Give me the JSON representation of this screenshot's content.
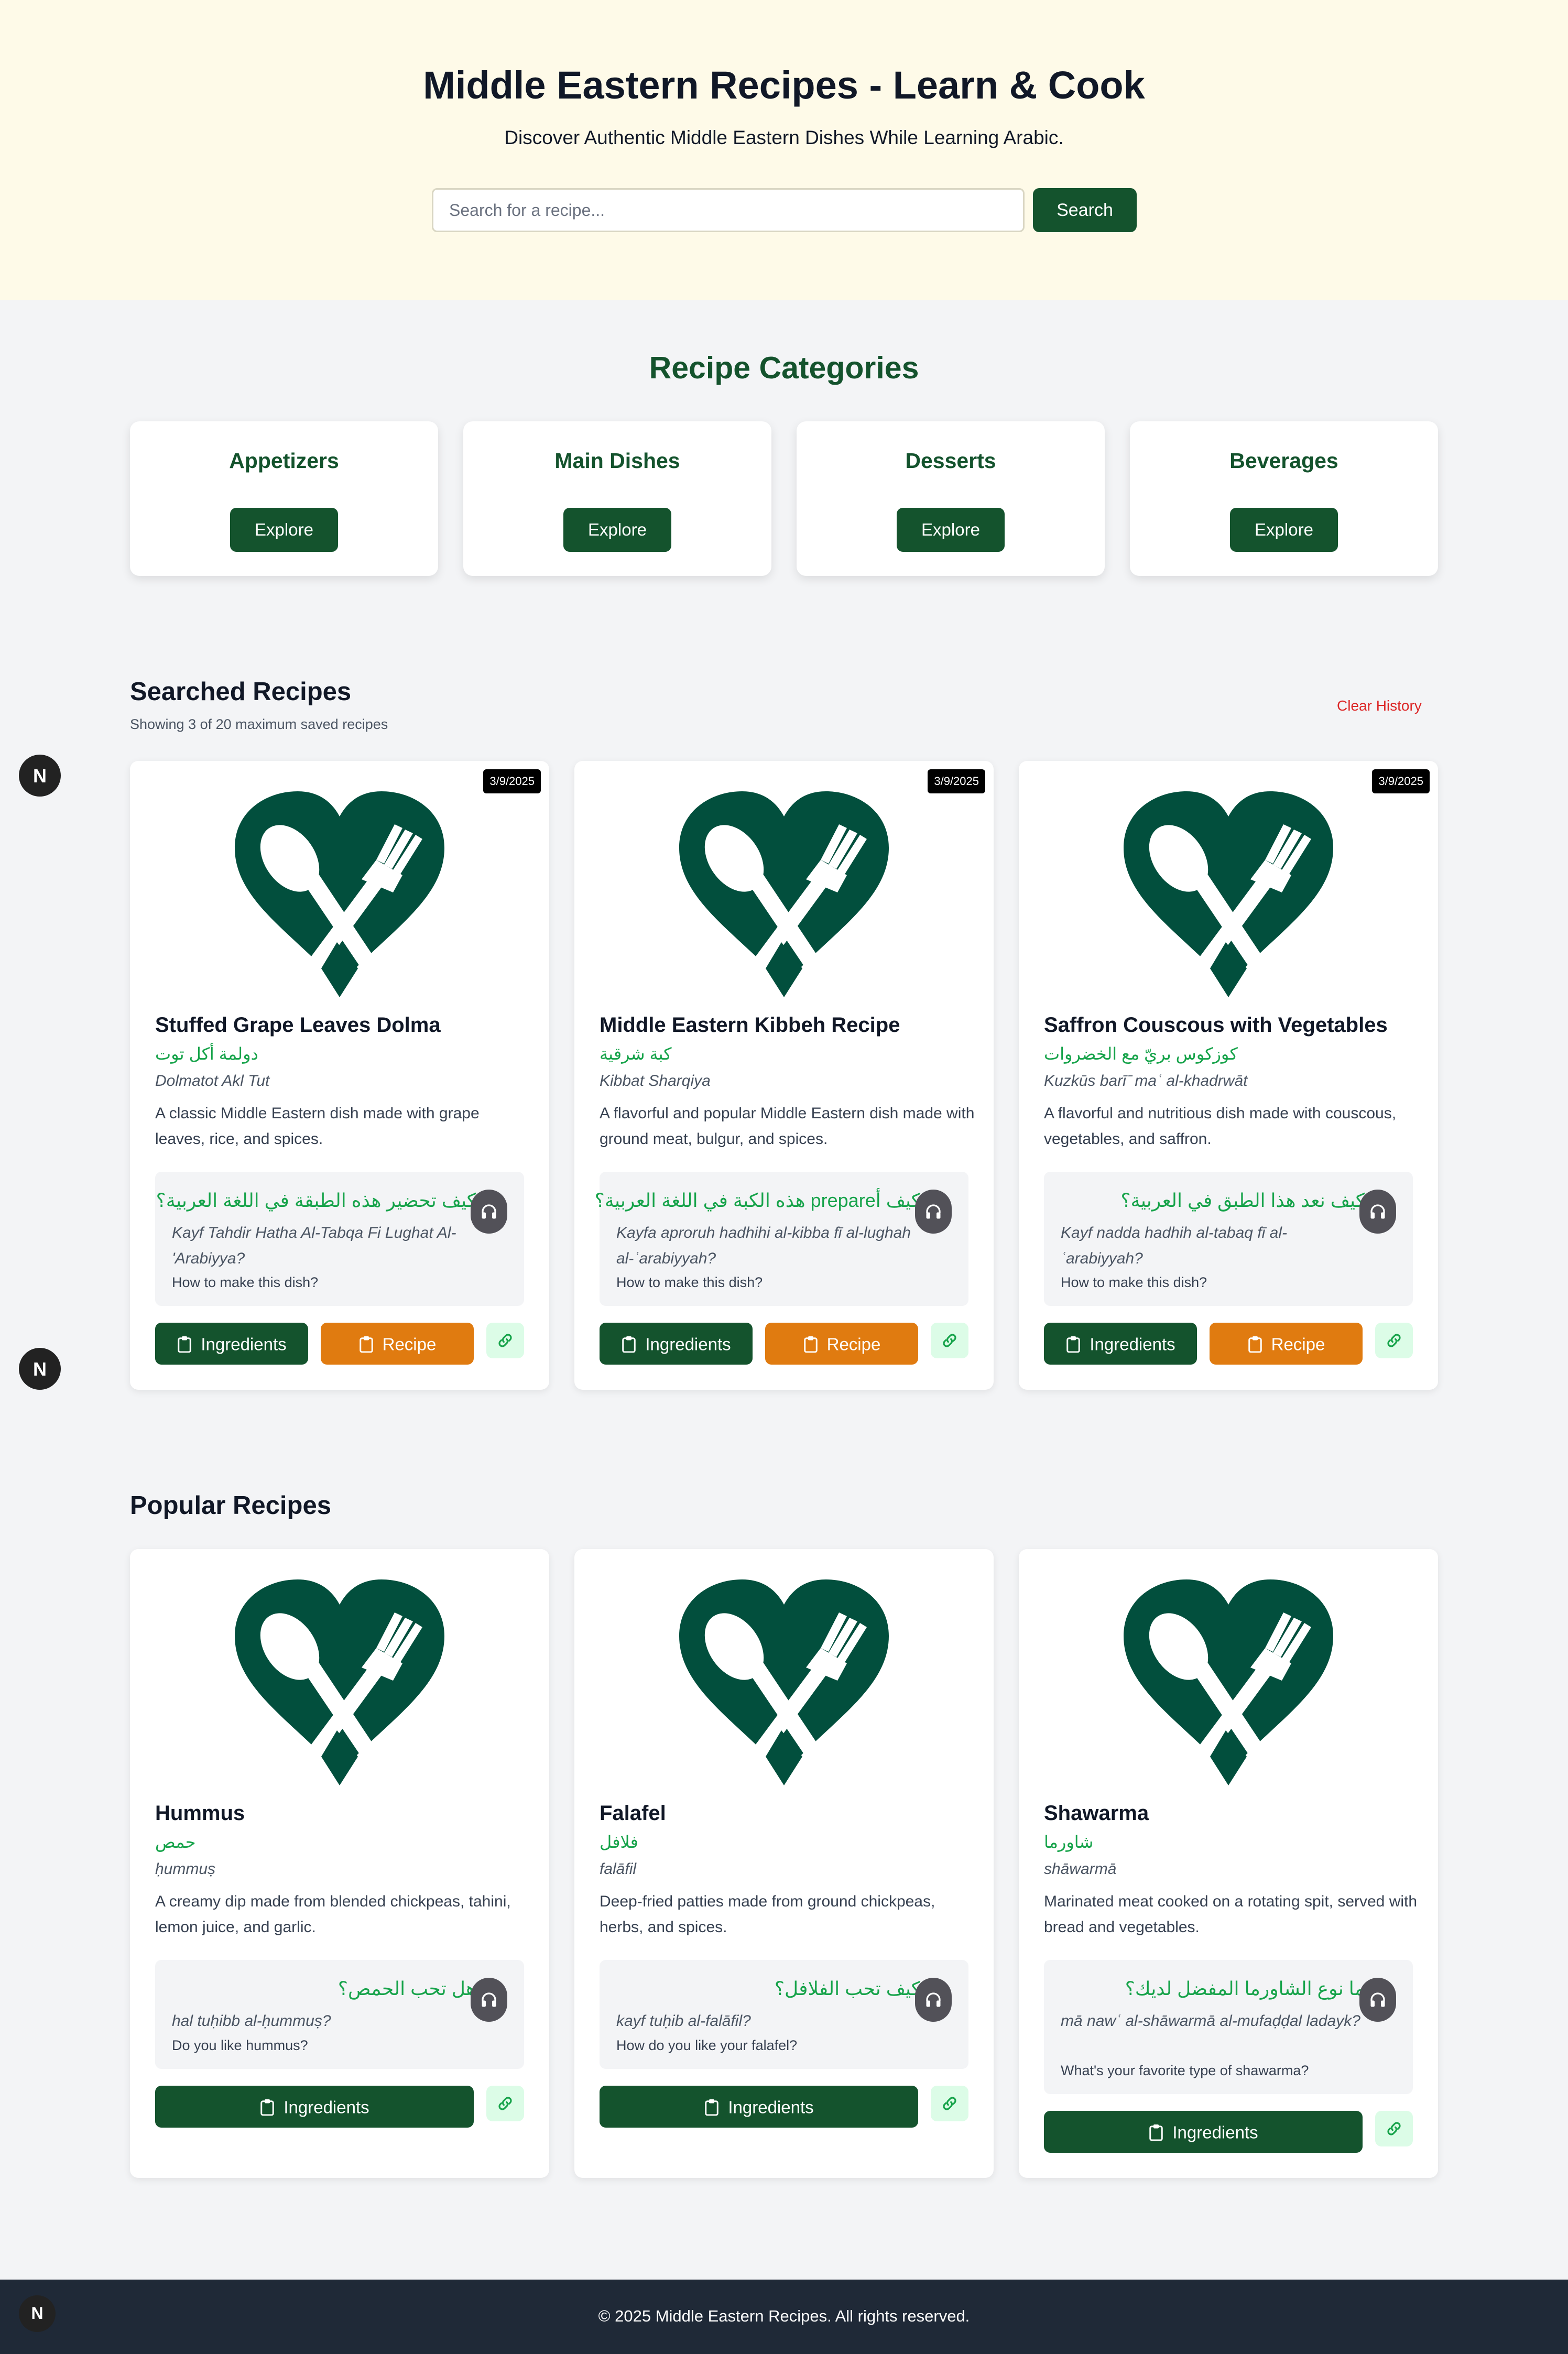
{
  "hero": {
    "title": "Middle Eastern Recipes - Learn & Cook",
    "subtitle": "Discover Authentic Middle Eastern Dishes While Learning Arabic.",
    "search_placeholder": "Search for a recipe...",
    "search_button": "Search"
  },
  "categories": {
    "title": "Recipe Categories",
    "items": [
      {
        "name": "Appetizers",
        "button": "Explore"
      },
      {
        "name": "Main Dishes",
        "button": "Explore"
      },
      {
        "name": "Desserts",
        "button": "Explore"
      },
      {
        "name": "Beverages",
        "button": "Explore"
      }
    ]
  },
  "searched": {
    "title": "Searched Recipes",
    "subtitle": "Showing 3 of 20 maximum saved recipes",
    "clear_label": "Clear History",
    "items": [
      {
        "date": "3/9/2025",
        "title": "Stuffed Grape Leaves Dolma",
        "arabic": "دولمة أكل توت",
        "translit": "Dolmatot Akl Tut",
        "desc": "A classic Middle Eastern dish made with grape leaves, rice, and spices.",
        "phrase_ar": "كيف تحضير هذه الطبقة في اللغة العربية؟",
        "phrase_tr": "Kayf Tahdir Hatha Al-Tabqa Fi Lughat Al-'Arabiyya?",
        "phrase_en": "How to make this dish?",
        "ing_label": "Ingredients",
        "rec_label": "Recipe"
      },
      {
        "date": "3/9/2025",
        "title": "Middle Eastern Kibbeh Recipe",
        "arabic": "كبة شرقية",
        "translit": "Kibbat Sharqiya",
        "desc": "A flavorful and popular Middle Eastern dish made with ground meat, bulgur, and spices.",
        "phrase_ar": "كيف أprepare هذه الكبة في اللغة العربية؟",
        "phrase_tr": "Kayfa aproruh hadhihi al-kibba fī al-lughah al-ʿarabiyyah?",
        "phrase_en": "How to make this dish?",
        "ing_label": "Ingredients",
        "rec_label": "Recipe"
      },
      {
        "date": "3/9/2025",
        "title": "Saffron Couscous with Vegetables",
        "arabic": "كوزكوس بريّ مع الخضروات",
        "translit": "Kuzkūs barī ̄ maʿ al-khadrwāt",
        "desc": "A flavorful and nutritious dish made with couscous, vegetables, and saffron.",
        "phrase_ar": "كيف نعد هذا الطبق في العربية؟",
        "phrase_tr": "Kayf nadda hadhih al-tabaq fī al-ʿarabiyyah?",
        "phrase_en": "How to make this dish?",
        "ing_label": "Ingredients",
        "rec_label": "Recipe"
      }
    ]
  },
  "popular": {
    "title": "Popular Recipes",
    "items": [
      {
        "title": "Hummus",
        "arabic": "حمص",
        "translit": "ḥummuṣ",
        "desc": "A creamy dip made from blended chickpeas, tahini, lemon juice, and garlic.",
        "phrase_ar": "هل تحب الحمص؟",
        "phrase_tr": "hal tuḥibb al-ḥummuṣ?",
        "phrase_en": "Do you like hummus?",
        "ing_label": "Ingredients"
      },
      {
        "title": "Falafel",
        "arabic": "فلافل",
        "translit": "falāfil",
        "desc": "Deep-fried patties made from ground chickpeas, herbs, and spices.",
        "phrase_ar": "كيف تحب الفلافل؟",
        "phrase_tr": "kayf tuḥib al-falāfil?",
        "phrase_en": "How do you like your falafel?",
        "ing_label": "Ingredients"
      },
      {
        "title": "Shawarma",
        "arabic": "شاورما",
        "translit": "shāwarmā",
        "desc": "Marinated meat cooked on a rotating spit, served with bread and vegetables.",
        "phrase_ar": "ما نوع الشاورما المفضل لديك؟",
        "phrase_tr": "mā nawʿ al-shāwarmā al-mufaḍḍal ladayk?",
        "phrase_en": "What's your favorite type of shawarma?",
        "ing_label": "Ingredients"
      }
    ]
  },
  "next_badge": "N",
  "footer": "© 2025 Middle Eastern Recipes. All rights reserved.",
  "colors": {
    "brand_green": "#14532d",
    "logo_green": "#024f3d",
    "accent_orange": "#e07b10",
    "arabic_green": "#16a34a",
    "hero_bg": "#fefae8"
  },
  "icons": [
    "heart-cutlery-logo-icon",
    "headphones-icon",
    "clipboard-icon",
    "link-icon"
  ]
}
